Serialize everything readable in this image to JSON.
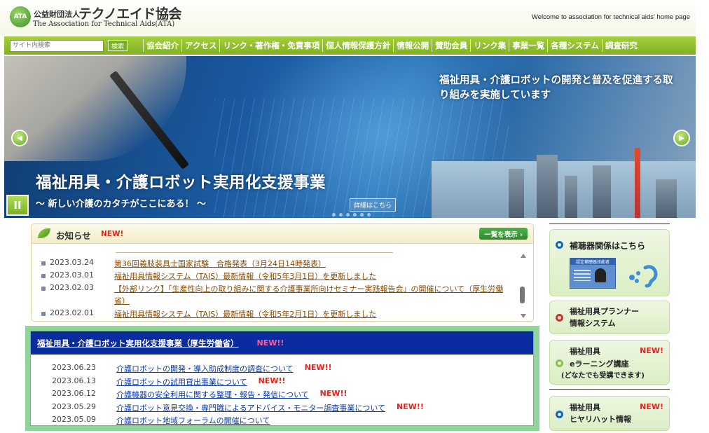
{
  "header": {
    "logo_mark": "ATA",
    "logo_jp_small": "公益財団法人",
    "logo_jp_big": "テクノエイド協会",
    "logo_en": "The Association for Technical Aids(ATA)",
    "welcome": "Welcome to association for technical aids' home page"
  },
  "search": {
    "placeholder": "サイト内検索",
    "button": "検索"
  },
  "nav": {
    "items": [
      "協会紹介",
      "アクセス",
      "リンク・著作権・免責事項",
      "個人情報保護方針",
      "情報公開",
      "賛助会員",
      "リンク集",
      "事業一覧",
      "各種システム",
      "調査研究"
    ]
  },
  "hero": {
    "tagline": "福祉用具・介護ロボットの開発と普及を促進する取り組みを実施しています",
    "title": "福祉用具・介護ロボット実用化支援事業",
    "subtitle": "～ 新しい介護のカタチがここにある！ ～",
    "detail_button": "詳細はこちら",
    "pause_label": "II"
  },
  "news": {
    "title": "お知らせ",
    "new_badge": "NEW!",
    "view_all": "一覧を表示 ›",
    "items": [
      {
        "date": "2023.03.24",
        "text": "第36回義肢装具士国家試験　合格発表（3月24日14時発表）"
      },
      {
        "date": "2023.03.01",
        "text": "福祉用具情報システム（TAIS）最新情報（令和5年3月1日）を更新しました"
      },
      {
        "date": "2023.02.03",
        "text": "【外部リンク】「生産性向上の取り組みに関する介護事業所向けセミナー実践報告会」の開催について（厚生労働省）"
      },
      {
        "date": "2023.02.01",
        "text": "福祉用具情報システム（TAIS）最新情報（令和5年2月1日）を更新しました"
      }
    ]
  },
  "project": {
    "title": "福祉用具・介護ロボット実用化支援事業（厚生労働省）",
    "new_badge": "NEW!!",
    "items": [
      {
        "date": "2023.06.23",
        "text": "介護ロボットの開発・導入助成制度の調査について",
        "new": "NEW!!"
      },
      {
        "date": "2023.06.13",
        "text": "介護ロボットの試用貸出事業について",
        "new": "NEW!!"
      },
      {
        "date": "2023.06.12",
        "text": "介護機器の安全利用に関する整理・報告・発信について",
        "new": "NEW!!"
      },
      {
        "date": "2023.05.29",
        "text": "介護ロボット意見交換・専門職によるアドバイス・モニター調査事業について",
        "new": "NEW!!"
      },
      {
        "date": "2023.05.09",
        "text": "介護ロボット地域フォーラムの開催について",
        "new": ""
      }
    ]
  },
  "sidebar": {
    "hearing": {
      "title": "補聴器関係はこちら",
      "badge_text": "認定補聴器技能者"
    },
    "planner": {
      "line1": "福祉用具プランナー",
      "line2": "情報システム"
    },
    "elearning": {
      "line1": "福祉用具",
      "line2": "eラーニング講座",
      "line3": "(どなたでも受講できます)",
      "new": "NEW!"
    },
    "hiyari": {
      "line1": "福祉用具",
      "line2": "ヒヤリハット情報",
      "new": "NEW!"
    }
  },
  "colors": {
    "nav_green": "#8cc034",
    "project_blue": "#0a2c9e",
    "link_brown": "#8a4b00",
    "link_blue": "#0a3aa8",
    "new_red": "#e8241b"
  }
}
